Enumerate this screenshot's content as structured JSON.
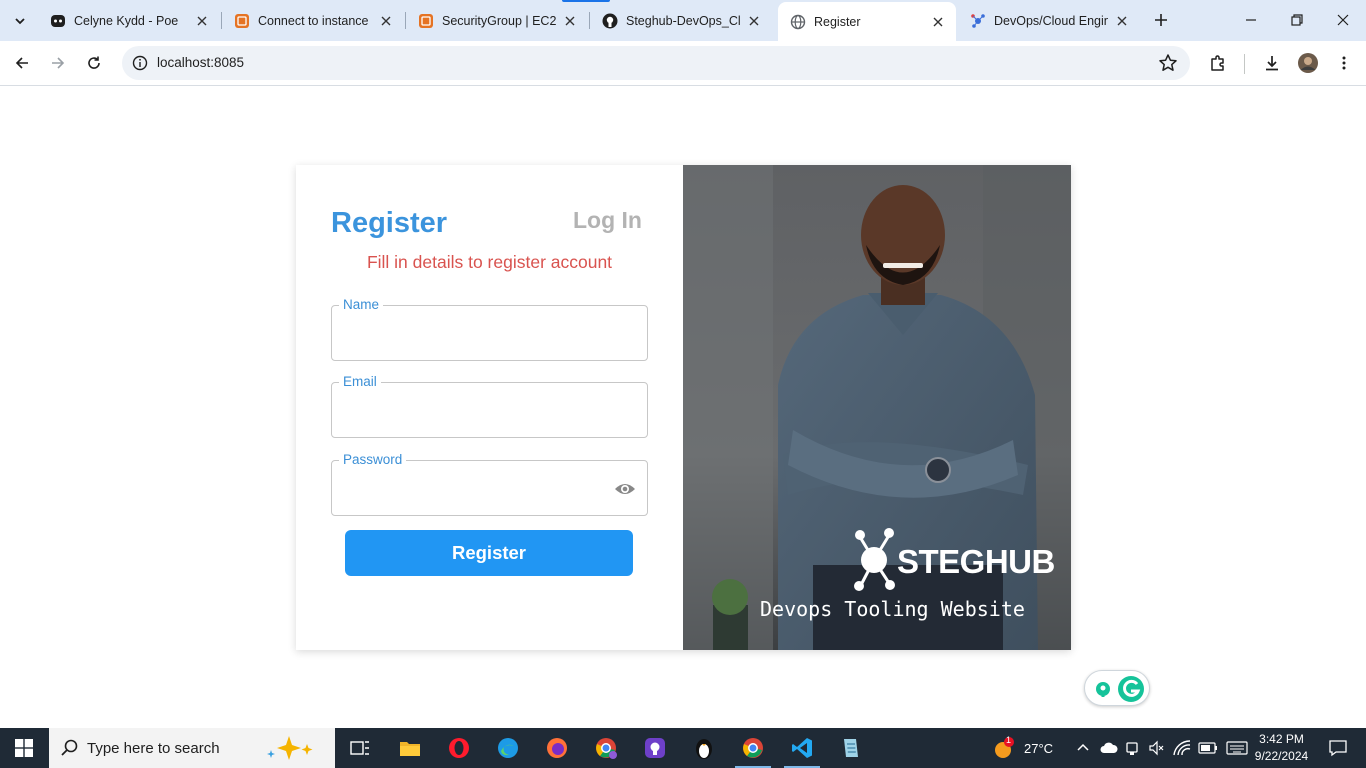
{
  "browser": {
    "tabs": [
      {
        "title": "Celyne Kydd - Poe"
      },
      {
        "title": "Connect to instance | "
      },
      {
        "title": "SecurityGroup | EC2 | "
      },
      {
        "title": "Steghub-DevOps_Clo"
      },
      {
        "title": "Register"
      },
      {
        "title": "DevOps/Cloud Engine"
      }
    ],
    "url": "localhost:8085"
  },
  "page": {
    "register_tab": "Register",
    "login_tab": "Log In",
    "subtitle": "Fill in details to register account",
    "fields": {
      "name_label": "Name",
      "email_label": "Email",
      "password_label": "Password"
    },
    "submit_label": "Register",
    "brand": "STEGHUB",
    "tagline": "Devops Tooling Website"
  },
  "taskbar": {
    "search_placeholder": "Type here to search",
    "weather_badge": "1",
    "temperature": "27°C",
    "time": "3:42 PM",
    "date": "9/22/2024"
  },
  "colors": {
    "accent": "#3b94dd",
    "button": "#2196f3",
    "subtitle": "#d9534f",
    "inactive_tab": "#b3b3b3"
  }
}
